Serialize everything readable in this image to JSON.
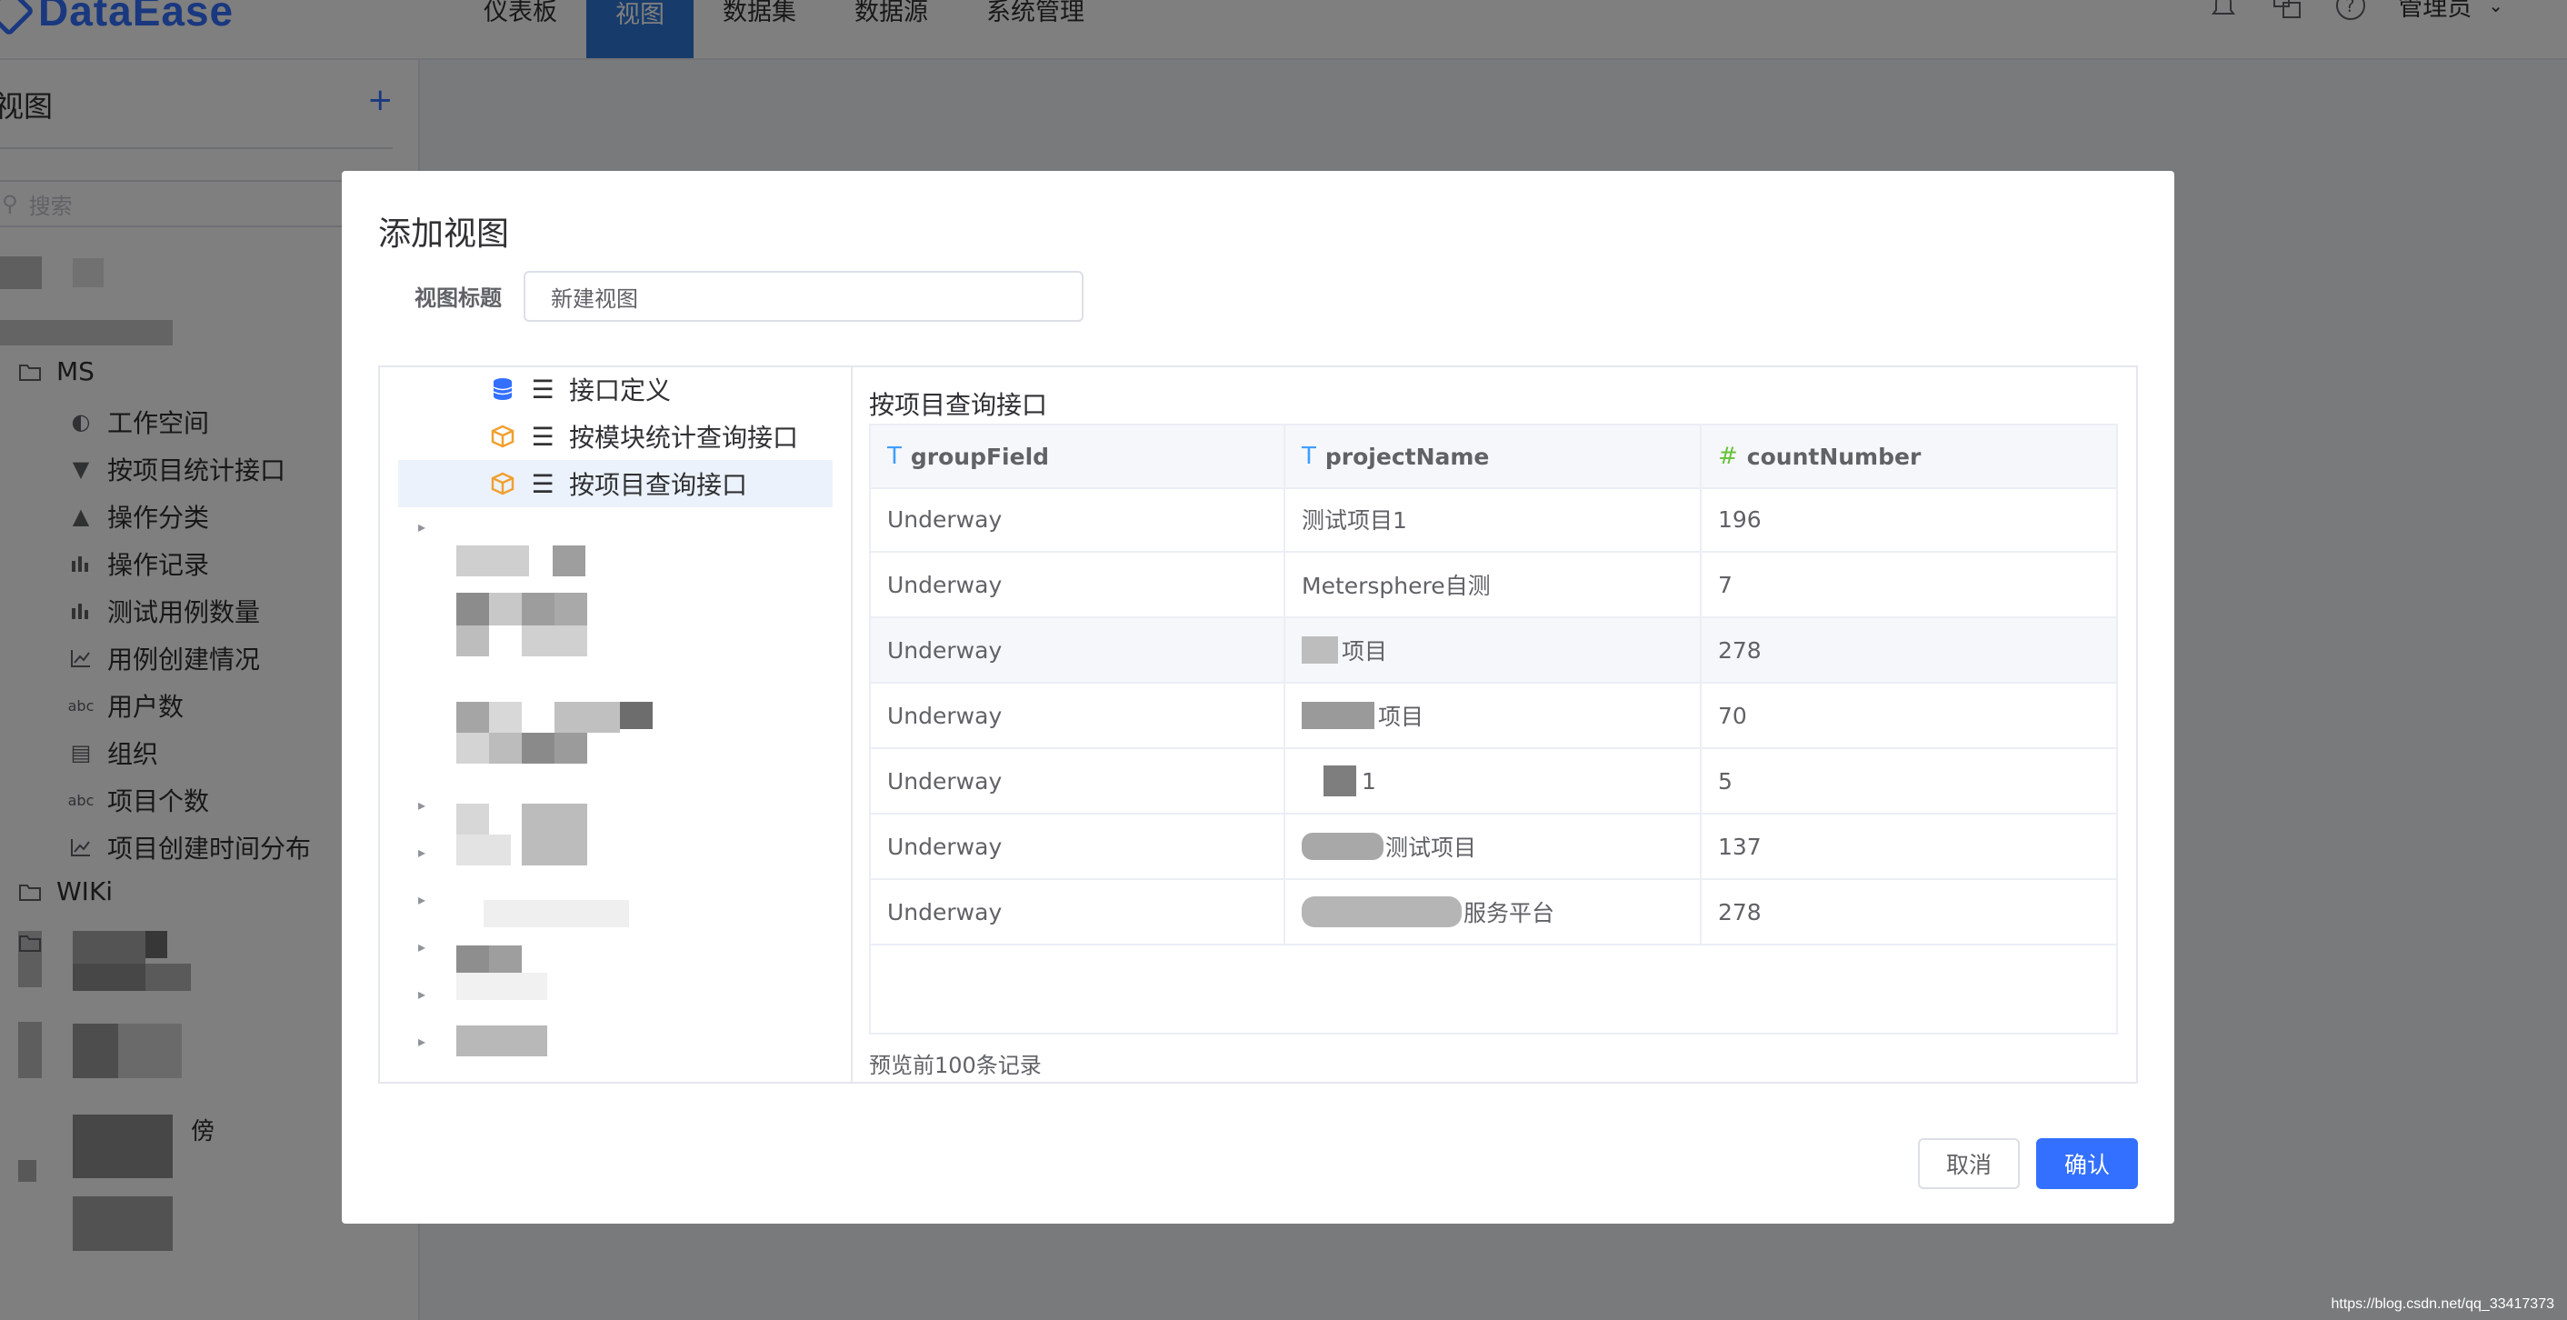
{
  "app": {
    "logo_text": "DataEase"
  },
  "nav": {
    "items": [
      "仪表板",
      "视图",
      "数据集",
      "数据源",
      "系统管理"
    ],
    "active": "视图"
  },
  "header": {
    "user": "管理员"
  },
  "sidebar": {
    "title": "视图",
    "search_placeholder": "搜索",
    "folders": [
      {
        "label": "MS",
        "items": [
          "工作空间",
          "按项目统计接口",
          "操作分类",
          "操作记录",
          "测试用例数量",
          "用例创建情况",
          "用户数",
          "组织",
          "项目个数",
          "项目创建时间分布"
        ]
      },
      {
        "label": "WIKi"
      }
    ],
    "partial_label": "傍"
  },
  "dialog": {
    "title": "添加视图",
    "view_title_label": "视图标题",
    "view_title_value": "新建视图",
    "datasets": [
      "接口定义",
      "按模块统计查询接口",
      "按项目查询接口"
    ],
    "selected_dataset": "按项目查询接口",
    "table": {
      "name": "按项目查询接口",
      "columns": [
        {
          "type_icon": "T",
          "name": "groupField"
        },
        {
          "type_icon": "T",
          "name": "projectName"
        },
        {
          "type_icon": "#",
          "name": "countNumber"
        }
      ],
      "rows": [
        [
          "Underway",
          "测试项目1",
          "196"
        ],
        [
          "Underway",
          "Metersphere自测",
          "7"
        ],
        [
          "Underway",
          "项目",
          "278"
        ],
        [
          "Underway",
          "项目",
          "70"
        ],
        [
          "Underway",
          "1",
          "5"
        ],
        [
          "Underway",
          "测试项目",
          "137"
        ],
        [
          "Underway",
          "服务平台",
          "278"
        ]
      ]
    },
    "preview_note": "预览前100条记录",
    "cancel_label": "取消",
    "confirm_label": "确认"
  },
  "watermark": "https://blog.csdn.net/qq_33417373",
  "colors": {
    "primary": "#3370ff",
    "nav_active": "#2f76d6",
    "overlay": "rgba(0,0,0,0.5)"
  }
}
